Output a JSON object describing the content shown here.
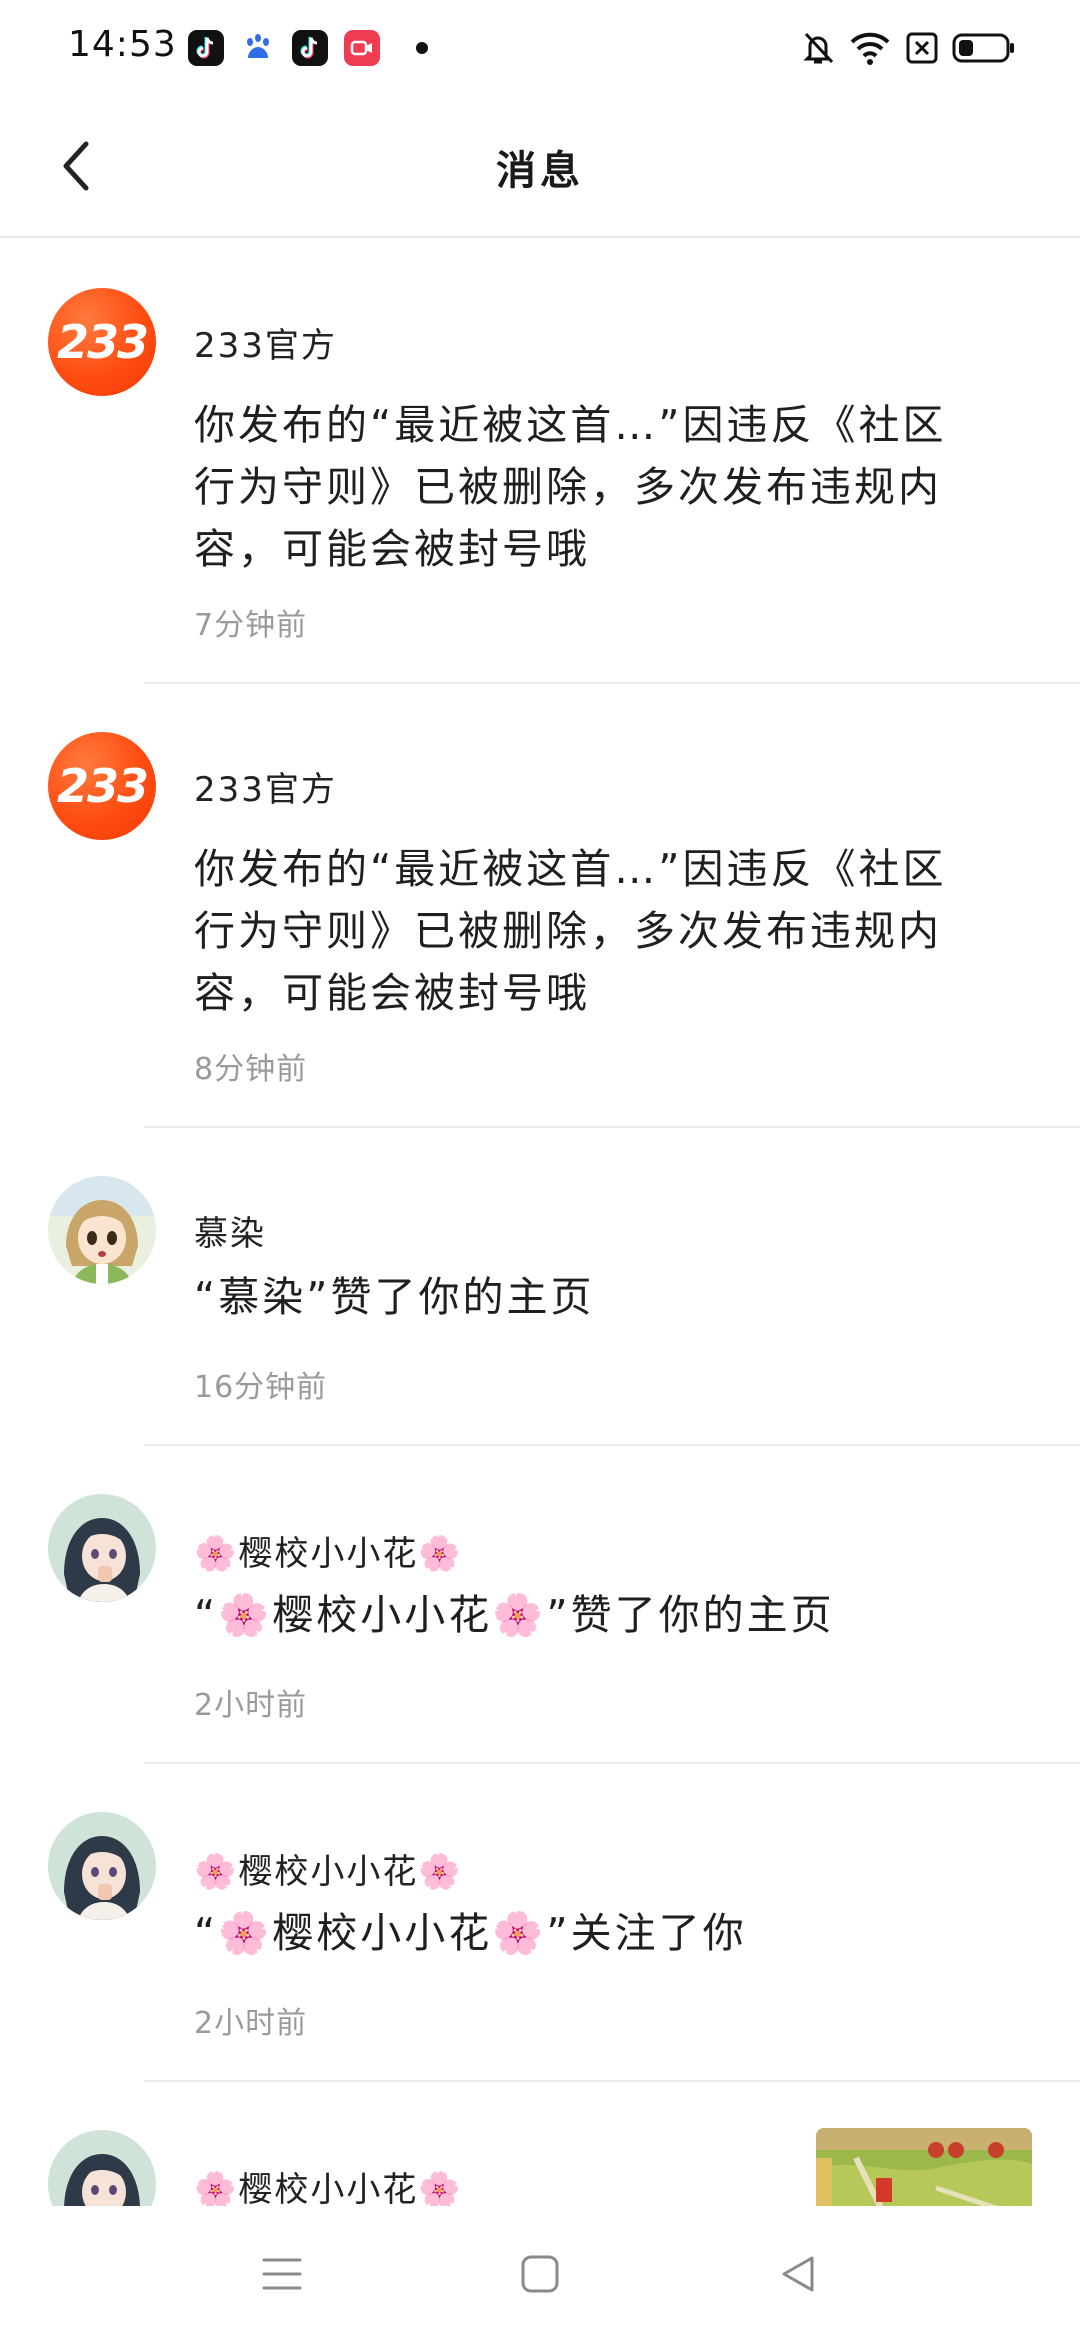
{
  "status_bar": {
    "time": "14:53",
    "notification_icons": [
      "tiktok-icon",
      "baidu-icon",
      "tiktok-icon",
      "video-call-icon"
    ],
    "right_icons": [
      "mute-bell-icon",
      "wifi-icon",
      "sim-off-icon",
      "battery-icon"
    ]
  },
  "header": {
    "title": "消息",
    "back_icon": "chevron-left-icon"
  },
  "messages": [
    {
      "sender": "233官方",
      "text": "你发布的“最近被这首…”因违反《社区行为守则》已被删除，多次发布违规内容，可能会被封号哦",
      "time": "7分钟前",
      "avatar": "233",
      "accent": "#ff4d12"
    },
    {
      "sender": "233官方",
      "text": "你发布的“最近被这首…”因违反《社区行为守则》已被删除，多次发布违规内容，可能会被封号哦",
      "time": "8分钟前",
      "avatar": "233",
      "accent": "#ff4d12"
    },
    {
      "sender": "慕染",
      "text": "“慕染”赞了你的主页",
      "time": "16分钟前",
      "avatar": "anime-girl-blonde"
    },
    {
      "sender": "🌸樱校小小花🌸",
      "text": "“🌸樱校小小花🌸”赞了你的主页",
      "time": "2小时前",
      "avatar": "anime-girl-dark-hair"
    },
    {
      "sender": "🌸樱校小小花🌸",
      "text": "“🌸樱校小小花🌸”关注了你",
      "time": "2小时前",
      "avatar": "anime-girl-dark-hair"
    },
    {
      "sender": "🌸樱校小小花🌸",
      "text": "",
      "time": "",
      "avatar": "anime-girl-dark-hair",
      "thumbnail": "game-screenshot"
    }
  ],
  "nav_bar": {
    "buttons": [
      "menu-icon",
      "home-square-icon",
      "back-triangle-icon"
    ]
  }
}
